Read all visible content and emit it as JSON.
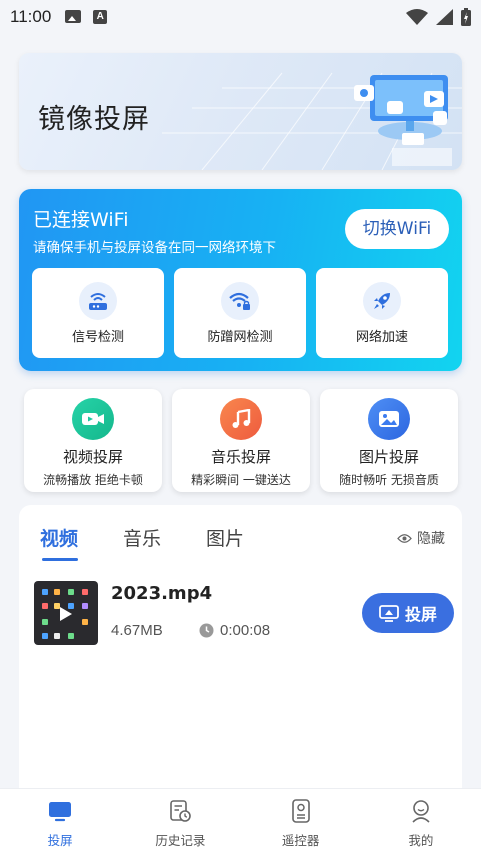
{
  "status_bar": {
    "time": "11:00"
  },
  "banner": {
    "title": "镜像投屏"
  },
  "wifi": {
    "title": "已连接WiFi",
    "subtitle": "请确保手机与投屏设备在同一网络环境下",
    "switch_label": "切换WiFi",
    "tools": [
      {
        "label": "信号检测",
        "icon": "router-icon"
      },
      {
        "label": "防蹭网检测",
        "icon": "wifi-lock-icon"
      },
      {
        "label": "网络加速",
        "icon": "rocket-icon"
      }
    ]
  },
  "features": [
    {
      "title": "视频投屏",
      "subtitle": "流畅播放 拒绝卡顿",
      "icon": "video-icon",
      "color": "#1fc8a0"
    },
    {
      "title": "音乐投屏",
      "subtitle": "精彩瞬间 一键送达",
      "icon": "music-icon",
      "color": "#f26a45"
    },
    {
      "title": "图片投屏",
      "subtitle": "随时畅听 无损音质",
      "icon": "image-icon",
      "color": "#3b7bef"
    }
  ],
  "media": {
    "tabs": [
      "视频",
      "音乐",
      "图片"
    ],
    "active_tab": "视频",
    "hide_label": "隐藏",
    "items": [
      {
        "name": "2023.mp4",
        "size": "4.67MB",
        "duration": "0:00:08",
        "cast_label": "投屏"
      }
    ]
  },
  "bottom_nav": {
    "items": [
      {
        "label": "投屏",
        "icon": "cast-icon",
        "active": true
      },
      {
        "label": "历史记录",
        "icon": "history-icon",
        "active": false
      },
      {
        "label": "遥控器",
        "icon": "remote-icon",
        "active": false
      },
      {
        "label": "我的",
        "icon": "profile-icon",
        "active": false
      }
    ]
  },
  "colors": {
    "primary": "#2f6fde",
    "cast_button": "#3a6fe0",
    "wifi_gradient_start": "#2196f3",
    "wifi_gradient_end": "#12d4f0"
  }
}
